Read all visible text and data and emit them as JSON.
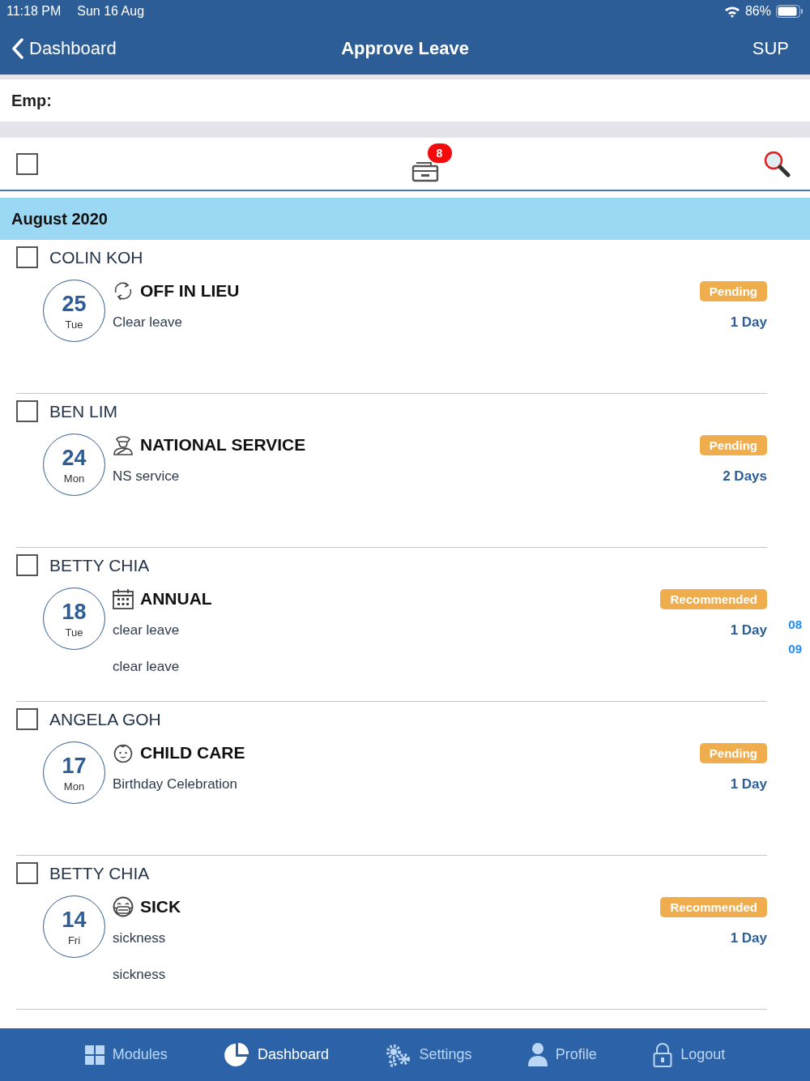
{
  "status_bar": {
    "time": "11:18 PM",
    "date": "Sun 16 Aug",
    "battery": "86%"
  },
  "nav": {
    "back": "Dashboard",
    "title": "Approve Leave",
    "right": "SUP"
  },
  "employee_filter": {
    "label": "Emp:"
  },
  "toolbar": {
    "select_all_checked": false,
    "badge": "8"
  },
  "month": "August 2020",
  "index": [
    "08",
    "09"
  ],
  "leaves": [
    {
      "name": "COLIN KOH",
      "checked": false,
      "day": "25",
      "weekday": "Tue",
      "kind": "lieu",
      "type": "OFF IN LIEU",
      "status": "Pending",
      "notes": [
        "Clear leave"
      ],
      "duration": "1 Day"
    },
    {
      "name": "BEN LIM",
      "checked": false,
      "day": "24",
      "weekday": "Mon",
      "kind": "service",
      "type": "NATIONAL SERVICE",
      "status": "Pending",
      "notes": [
        "NS service"
      ],
      "duration": "2 Days"
    },
    {
      "name": "BETTY CHIA",
      "checked": false,
      "day": "18",
      "weekday": "Tue",
      "kind": "annual",
      "type": "ANNUAL",
      "status": "Recommended",
      "notes": [
        "clear leave",
        "clear leave"
      ],
      "duration": "1 Day"
    },
    {
      "name": "ANGELA GOH",
      "checked": false,
      "day": "17",
      "weekday": "Mon",
      "kind": "childcare",
      "type": "CHILD CARE",
      "status": "Pending",
      "notes": [
        "Birthday Celebration"
      ],
      "duration": "1 Day"
    },
    {
      "name": "BETTY CHIA",
      "checked": false,
      "day": "14",
      "weekday": "Fri",
      "kind": "sick",
      "type": "SICK",
      "status": "Recommended",
      "notes": [
        "sickness",
        "sickness"
      ],
      "duration": "1 Day"
    }
  ],
  "tabs": [
    {
      "label": "Modules",
      "kind": "modules",
      "selected": false
    },
    {
      "label": "Dashboard",
      "kind": "dashboard",
      "selected": true
    },
    {
      "label": "Settings",
      "kind": "settings",
      "selected": false
    },
    {
      "label": "Profile",
      "kind": "profile",
      "selected": false
    },
    {
      "label": "Logout",
      "kind": "logout",
      "selected": false
    }
  ]
}
